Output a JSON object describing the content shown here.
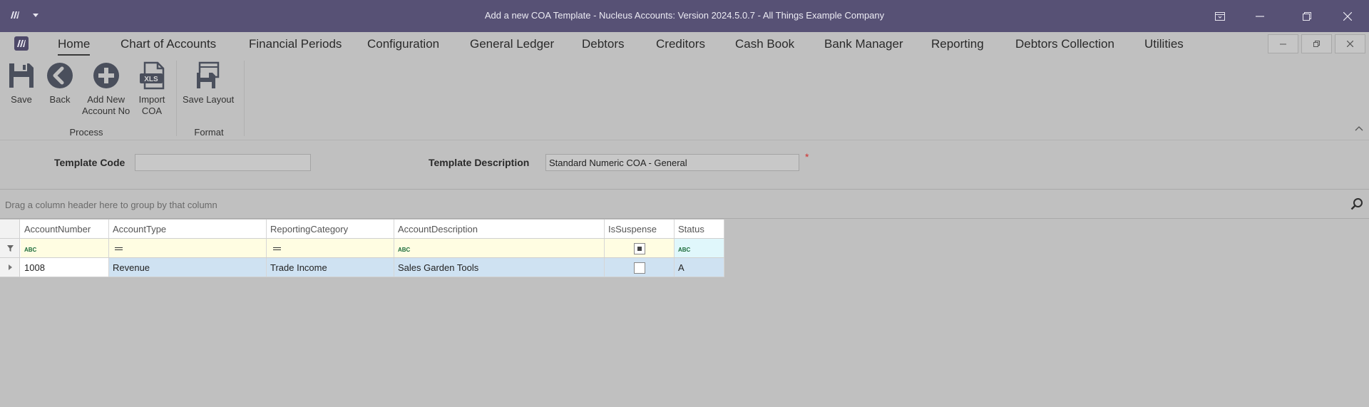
{
  "window": {
    "title": "Add a new COA Template - Nucleus Accounts: Version 2024.5.0.7 - All Things Example Company"
  },
  "menu": {
    "tabs": [
      {
        "label": "Home"
      },
      {
        "label": "Chart of Accounts"
      },
      {
        "label": "Financial Periods"
      },
      {
        "label": "Configuration"
      },
      {
        "label": "General Ledger"
      },
      {
        "label": "Debtors"
      },
      {
        "label": "Creditors"
      },
      {
        "label": "Cash Book"
      },
      {
        "label": "Bank Manager"
      },
      {
        "label": "Reporting"
      },
      {
        "label": "Debtors Collection"
      },
      {
        "label": "Utilities"
      }
    ],
    "active_tab": "Home"
  },
  "ribbon": {
    "buttons": {
      "save": "Save",
      "back": "Back",
      "add_new": "Add New\nAccount No",
      "import": "Import\nCOA",
      "save_layout": "Save Layout"
    },
    "groups": {
      "process": "Process",
      "format": "Format"
    },
    "xls_badge": "XLS"
  },
  "form": {
    "template_code_label": "Template Code",
    "template_code_value": "",
    "template_description_label": "Template Description",
    "template_description_value": "Standard Numeric COA - General",
    "required_marker": "*"
  },
  "grid": {
    "group_hint": "Drag a column header here to group by that column",
    "columns": [
      "AccountNumber",
      "AccountType",
      "ReportingCategory",
      "AccountDescription",
      "IsSuspense",
      "Status"
    ],
    "filter_row": {
      "account_number": "ABC",
      "account_type": "=",
      "reporting_category": "=",
      "account_description": "ABC",
      "status": "ABC"
    },
    "rows": [
      {
        "account_number": "1008",
        "account_type": "Revenue",
        "reporting_category": "Trade Income",
        "account_description": "Sales Garden Tools",
        "is_suspense": false,
        "status": "A"
      }
    ]
  },
  "colors": {
    "titlebar": "#575175",
    "background": "#c0c0c0",
    "selected_row": "#cfe2f2",
    "filter_row": "#fffde2",
    "required": "#d0302e"
  }
}
